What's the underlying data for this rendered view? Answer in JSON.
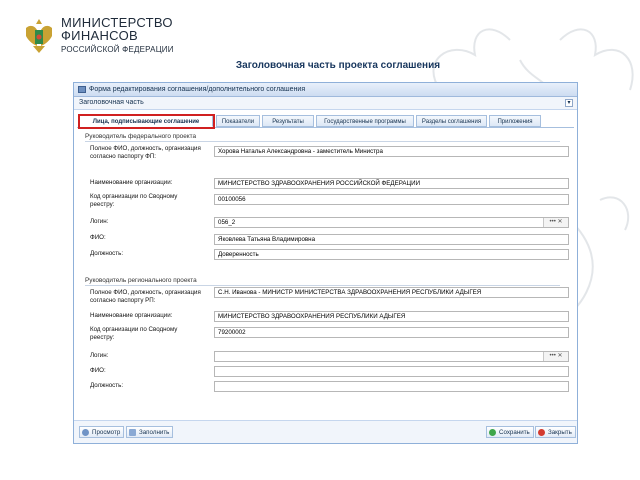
{
  "brand": {
    "line1": "МИНИСТЕРСТВО",
    "line2": "ФИНАНСОВ",
    "line3": "РОССИЙСКОЙ ФЕДЕРАЦИИ"
  },
  "slide_title": "Заголовочная часть проекта соглашения",
  "window": {
    "title": "Форма редактирования соглашения/дополнительного соглашения",
    "panel_title": "Заголовочная часть"
  },
  "tabs": [
    {
      "label": "Лица, подписывающие соглашение",
      "active": true
    },
    {
      "label": "Показатели",
      "active": false
    },
    {
      "label": "Результаты",
      "active": false
    },
    {
      "label": "Государственные программы",
      "active": false
    },
    {
      "label": "Разделы соглашения",
      "active": false
    },
    {
      "label": "Приложения",
      "active": false
    }
  ],
  "federal": {
    "section_title": "Руководитель федерального проекта",
    "fields": [
      {
        "label": "Полное ФИО, должность, организация согласно паспорту ФП:",
        "value": "Хорова Наталья Александровна - заместитель Министра"
      },
      {
        "label": "Наименование организации:",
        "value": "МИНИСТЕРСТВО ЗДРАВООХРАНЕНИЯ РОССИЙСКОЙ ФЕДЕРАЦИИ"
      },
      {
        "label": "Код организации по Сводному реестру:",
        "value": "00100056"
      },
      {
        "label": "Логин:",
        "value": "056_2"
      },
      {
        "label": "ФИО:",
        "value": "Яковлева Татьяна Владимировна"
      },
      {
        "label": "Должность:",
        "value": "Доверенность"
      }
    ]
  },
  "regional": {
    "section_title": "Руководитель регионального проекта",
    "fields": [
      {
        "label": "Полное ФИО, должность, организация согласно паспорту РП:",
        "value": "С.Н. Иванова - МИНИСТР МИНИСТЕРСТВА ЗДРАВООХРАНЕНИЯ РЕСПУБЛИКИ АДЫГЕЯ"
      },
      {
        "label": "Наименование организации:",
        "value": "МИНИСТЕРСТВО ЗДРАВООХРАНЕНИЯ РЕСПУБЛИКИ АДЫГЕЯ"
      },
      {
        "label": "Код организации по Сводному реестру:",
        "value": "79200002"
      },
      {
        "label": "Логин:",
        "value": ""
      },
      {
        "label": "ФИО:",
        "value": ""
      },
      {
        "label": "Должность:",
        "value": ""
      }
    ]
  },
  "lookup_buttons": "••• ✕",
  "footer": {
    "preview": "Просмотр",
    "fill": "Заполнить",
    "save": "Сохранить",
    "close": "Закрыть"
  },
  "colors": {
    "accent": "#17365d",
    "highlight": "#d02020",
    "window_border": "#8fb0d9"
  }
}
